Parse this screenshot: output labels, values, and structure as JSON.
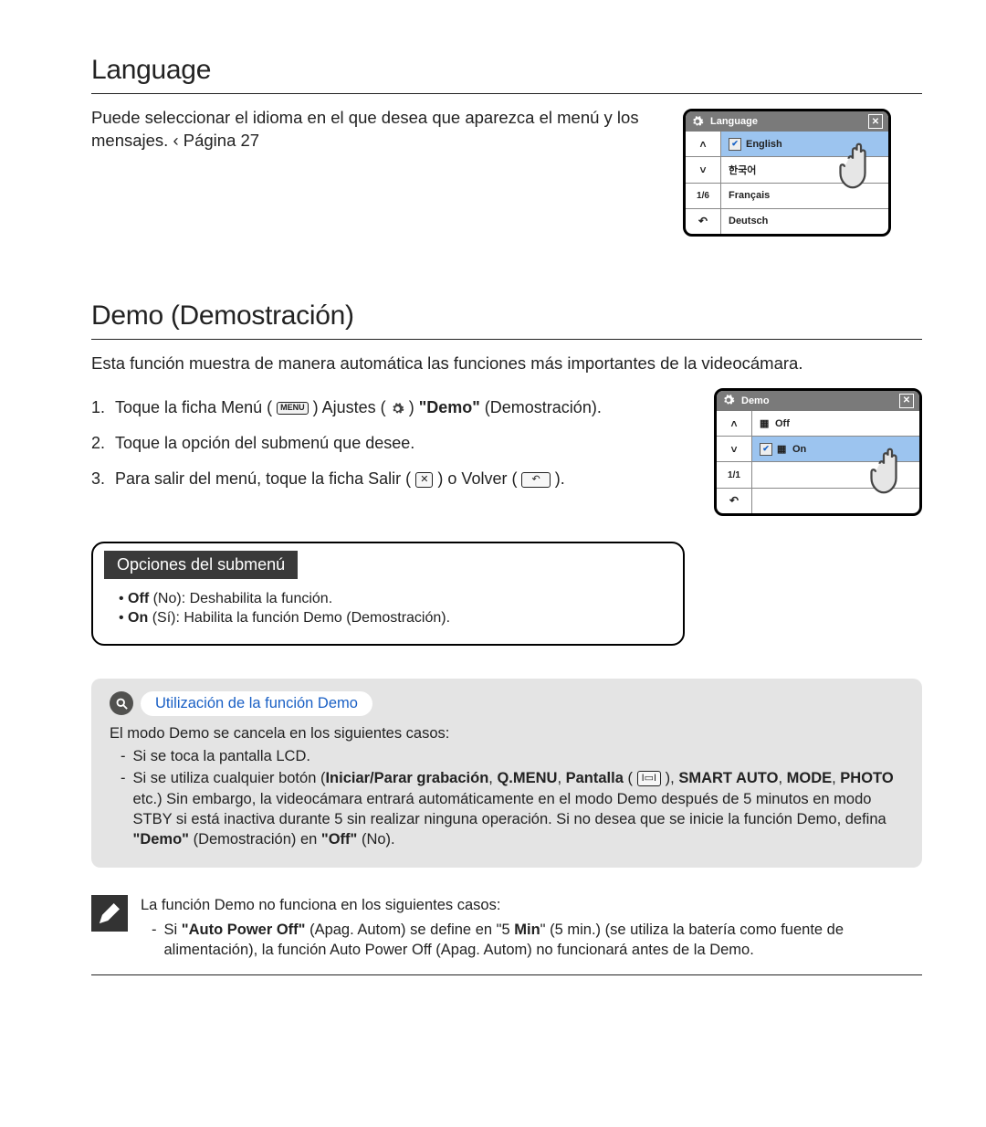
{
  "section1": {
    "title": "Language",
    "desc_a": "Puede seleccionar el idioma en el que desea que aparezca el menú y los mensajes.",
    "desc_pageref": "  ‹ Página 27"
  },
  "lang_screen": {
    "title": "Language",
    "items": [
      "English",
      "한국어",
      "Français",
      "Deutsch"
    ],
    "selected_index": 0,
    "page": "1/6"
  },
  "section2": {
    "title": "Demo (Demostración)",
    "intro": "Esta función muestra de manera automática las funciones más importantes de la videocámara.",
    "steps": {
      "s1_a": "Toque la ficha Menú (",
      "s1_menu": "MENU",
      "s1_b": ")    Ajustes (",
      "s1_c": ")   ",
      "s1_demo": "\"Demo\"",
      "s1_d": " (Demostración).",
      "s2": "Toque la opción del submenú que desee.",
      "s3_a": "Para salir del menú, toque la ficha Salir (",
      "s3_b": ") o Volver (",
      "s3_c": ")."
    }
  },
  "demo_screen": {
    "title": "Demo",
    "items": [
      {
        "label": "Off",
        "checked": false
      },
      {
        "label": "On",
        "checked": true
      }
    ],
    "selected_index": 1,
    "page": "1/1"
  },
  "submenu": {
    "title": "Opciones del submenú",
    "off_b": "Off",
    "off_t": " (No): Deshabilita la función.",
    "on_b": "On",
    "on_t": " (Sí): Habilita la función Demo (Demostración)."
  },
  "info": {
    "pill": "Utilización de la función Demo",
    "line1": "El modo Demo se cancela en los siguientes casos:",
    "dash1": "Si se toca la pantalla LCD.",
    "dash2_a": "Si se utiliza cualquier botón (",
    "dash2_b1": "Iniciar/Parar grabación",
    "dash2_b2": "Q.MENU",
    "dash2_b3": "Pantalla",
    "dash2_b4": "SMART AUTO",
    "dash2_b5": "MODE",
    "dash2_b6": "PHOTO",
    "dash2_c": " etc.) Sin embargo, la videocámara entrará automáticamente en el modo Demo después de 5 minutos en modo STBY si está inactiva durante 5 sin realizar ninguna operación. Si no desea que se inicie la función Demo, defina ",
    "dash2_d": "\"Demo\"",
    "dash2_e": " (Demostración) en ",
    "dash2_f": "\"Off\"",
    "dash2_g": " (No)."
  },
  "note": {
    "line1": "La función Demo no funciona en los siguientes casos:",
    "dash_a": "Si ",
    "dash_b": "\"Auto Power Off\"",
    "dash_c": " (Apag. Autom) se define en \"5",
    "dash_d": " Min",
    "dash_e": "\" (5 min.) (se utiliza la batería como fuente de alimentación), la función Auto Power Off (Apag. Autom) no funcionará antes de la Demo."
  }
}
